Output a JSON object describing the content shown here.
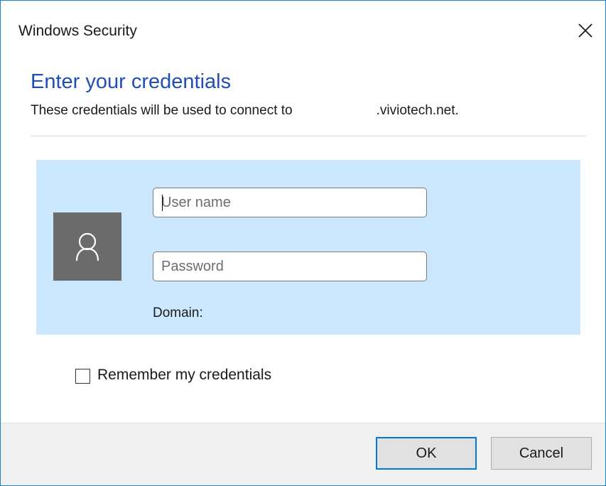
{
  "window": {
    "title": "Windows Security"
  },
  "header": {
    "heading": "Enter your credentials",
    "subtext_prefix": "These credentials will be used to connect to",
    "server": ".viviotech.net."
  },
  "credentials": {
    "username_placeholder": "User name",
    "password_placeholder": "Password",
    "domain_label": "Domain:"
  },
  "remember": {
    "label": "Remember my credentials",
    "checked": false
  },
  "buttons": {
    "ok": "OK",
    "cancel": "Cancel"
  },
  "icons": {
    "close": "close-icon",
    "user": "user-icon"
  },
  "colors": {
    "accent": "#0078d7",
    "heading": "#1f4fb5",
    "panel": "#cce8ff",
    "avatar": "#6b6b6b"
  }
}
